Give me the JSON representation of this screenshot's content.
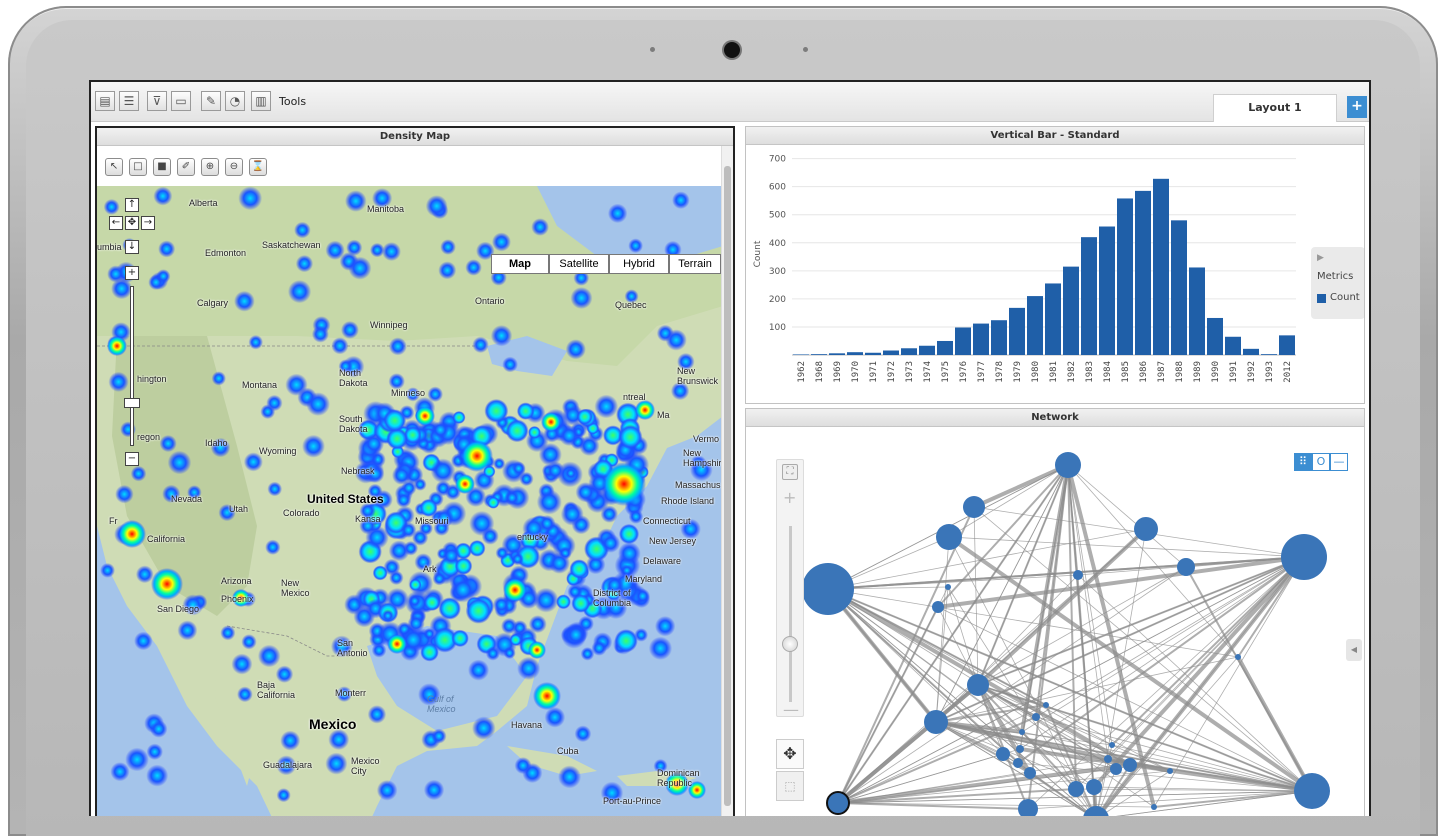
{
  "toolbar": {
    "tools_label": "Tools",
    "buttons": [
      {
        "icon": "table-icon",
        "glyph": "▤"
      },
      {
        "icon": "list-icon",
        "glyph": "☰"
      },
      {
        "icon": "filter-icon",
        "glyph": "⊽"
      },
      {
        "icon": "window-icon",
        "glyph": "▭"
      },
      {
        "icon": "edit-chart-icon",
        "glyph": "✎"
      },
      {
        "icon": "chart-settings-icon",
        "glyph": "◔"
      },
      {
        "icon": "chart-export-icon",
        "glyph": "▥"
      }
    ]
  },
  "tabs": {
    "active_label": "Layout 1",
    "add_label": "+"
  },
  "density_map": {
    "title": "Density Map",
    "tool_icons": [
      {
        "name": "select-icon",
        "glyph": "↖"
      },
      {
        "name": "rectangle-icon",
        "glyph": "□"
      },
      {
        "name": "layer-icon",
        "glyph": "■"
      },
      {
        "name": "draw-icon",
        "glyph": "✐"
      },
      {
        "name": "zoom-in-icon",
        "glyph": "⊕"
      },
      {
        "name": "zoom-out-icon",
        "glyph": "⊖"
      },
      {
        "name": "clear-icon",
        "glyph": "⌛"
      }
    ],
    "map_types": [
      "Map",
      "Satellite",
      "Hybrid",
      "Terrain"
    ],
    "active_map_type": "Map",
    "labels": {
      "alberta": "Alberta",
      "manitoba": "Manitoba",
      "saskatchewan": "Saskatchewan",
      "edmonton": "Edmonton",
      "calgary": "Calgary",
      "ontario": "Ontario",
      "quebec": "Quebec",
      "winnipeg": "Winnipeg",
      "columbia": "umbia",
      "washington": "hington",
      "montana": "Montana",
      "north_dakota": "North Dakota",
      "minnesota": "Minneso",
      "south_dakota": "South Dakota",
      "oregon": "regon",
      "idaho": "Idaho",
      "wyoming": "Wyoming",
      "nebraska": "Nebrask",
      "nevada": "Nevada",
      "utah": "Utah",
      "colorado": "Colorado",
      "united_states": "United States",
      "kansas": "Kansa",
      "missouri": "Missouri",
      "kentucky": "entucky",
      "san_francisco": "Fr",
      "california": "California",
      "arizona": "Arizona",
      "new_mexico": "New Mexico",
      "phoenix": "Phoenix",
      "san_diego": "San Diego",
      "arkansas": "Ark",
      "san_antonio": "San Antonio",
      "monterrey": "Monterr",
      "baja": "Baja California",
      "gulf": "Gulf of Mexico",
      "mexico": "Mexico",
      "guadalajara": "Guadalajara",
      "mexico_city": "Mexico City",
      "havana": "Havana",
      "cuba": "Cuba",
      "port_au_prince": "Port-au-Prince",
      "dominican": "Dominican Republic",
      "montreal": "ntreal",
      "new_brunswick": "New Brunswick",
      "maine": "Ma",
      "vermont": "Vermo",
      "new_hampshire": "New Hampshire",
      "massachusetts": "Massachus",
      "rhode_island": "Rhode Island",
      "connecticut": "Connecticut",
      "new_jersey": "New Jersey",
      "delaware": "Delaware",
      "maryland": "Maryland",
      "district_of_columbia": "District of Columbia"
    }
  },
  "bar_panel": {
    "title": "Vertical Bar - Standard",
    "legend_title": "Metrics",
    "legend_item": "Count",
    "bar_color": "#1f5fa8"
  },
  "chart_data": {
    "type": "bar",
    "title": "Vertical Bar - Standard",
    "xlabel": "",
    "ylabel": "Count",
    "ylim": [
      0,
      720
    ],
    "yticks": [
      100,
      200,
      300,
      400,
      500,
      600,
      700
    ],
    "grid": true,
    "legend": "right",
    "categories": [
      "1962",
      "1968",
      "1969",
      "1970",
      "1971",
      "1972",
      "1973",
      "1974",
      "1975",
      "1976",
      "1977",
      "1978",
      "1979",
      "1980",
      "1981",
      "1982",
      "1983",
      "1984",
      "1985",
      "1986",
      "1987",
      "1988",
      "1989",
      "1990",
      "1991",
      "1992",
      "1993",
      "2012"
    ],
    "series": [
      {
        "name": "Count",
        "values": [
          2,
          3,
          6,
          10,
          8,
          16,
          24,
          33,
          50,
          98,
          112,
          124,
          168,
          210,
          255,
          315,
          420,
          458,
          558,
          585,
          628,
          480,
          312,
          132,
          65,
          22,
          3,
          70
        ]
      }
    ]
  },
  "network": {
    "title": "Network",
    "zoom_fit_icon": "⛶",
    "plus_label": "+",
    "minus_label": "—",
    "pan_icon": "✥",
    "select_icon": "⬚",
    "mode_icons": [
      "⠿",
      "O",
      "—"
    ],
    "collapse_icon": "◀"
  }
}
